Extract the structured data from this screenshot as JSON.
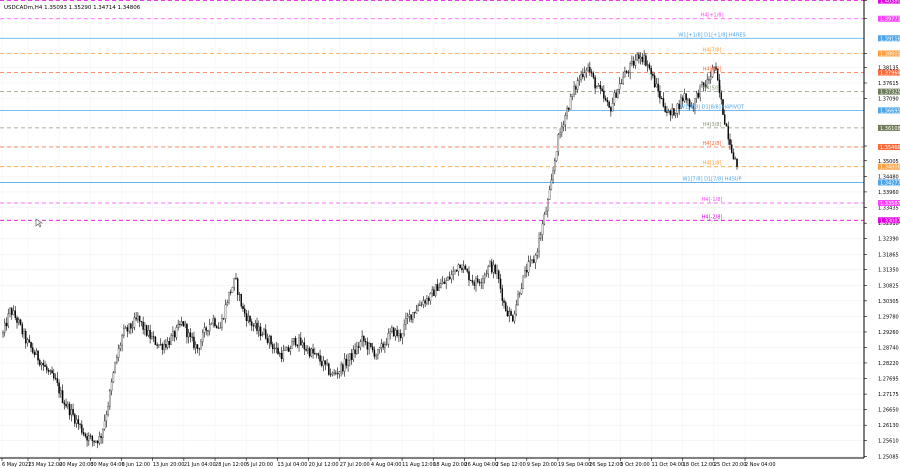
{
  "chart_data": {
    "type": "candlestick",
    "title": "USDCADm,H4  1.35093 1.35290 1.34714 1.34806",
    "ylim": [
      1.2503,
      1.404
    ],
    "grid": true,
    "y_ticks": [
      "1.40380",
      "1.39771",
      "1.38605",
      "1.38135",
      "1.37615",
      "1.37090",
      "1.35500",
      "1.35005",
      "1.34480",
      "1.33960",
      "1.33435",
      "1.32910",
      "1.32390",
      "1.31865",
      "1.31350",
      "1.30825",
      "1.30305",
      "1.29780",
      "1.29260",
      "1.28740",
      "1.28220",
      "1.27695",
      "1.27175",
      "1.26650",
      "1.26130",
      "1.25610",
      "1.25085"
    ],
    "x_ticks": [
      "6 May 2022",
      "13 May 12:00",
      "20 May 20:00",
      "30 May 04:00",
      "6 Jun 12:00",
      "13 Jun 20:00",
      "21 Jun 04:00",
      "28 Jun 12:00",
      "5 Jul 20:00",
      "13 Jul 04:00",
      "20 Jul 12:00",
      "27 Jul 20:00",
      "4 Aug 04:00",
      "11 Aug 12:00",
      "18 Aug 20:00",
      "26 Aug 04:00",
      "2 Sep 12:00",
      "9 Sep 20:00",
      "19 Sep 04:00",
      "26 Sep 12:00",
      "3 Oct 20:00",
      "11 Oct 04:00",
      "18 Oct 12:00",
      "25 Oct 20:00",
      "2 Nov 04:00"
    ],
    "price_path": [
      1.292,
      1.3,
      1.296,
      1.29,
      1.286,
      1.283,
      1.279,
      1.276,
      1.27,
      1.266,
      1.262,
      1.258,
      1.256,
      1.257,
      1.268,
      1.282,
      1.292,
      1.294,
      1.297,
      1.293,
      1.29,
      1.288,
      1.289,
      1.292,
      1.296,
      1.29,
      1.287,
      1.293,
      1.297,
      1.294,
      1.304,
      1.31,
      1.3,
      1.296,
      1.293,
      1.292,
      1.288,
      1.285,
      1.286,
      1.29,
      1.288,
      1.286,
      1.284,
      1.281,
      1.278,
      1.28,
      1.283,
      1.286,
      1.29,
      1.287,
      1.285,
      1.289,
      1.293,
      1.291,
      1.297,
      1.3,
      1.303,
      1.304,
      1.308,
      1.309,
      1.312,
      1.316,
      1.312,
      1.309,
      1.311,
      1.315,
      1.312,
      1.301,
      1.297,
      1.307,
      1.314,
      1.317,
      1.328,
      1.339,
      1.356,
      1.365,
      1.372,
      1.378,
      1.382,
      1.376,
      1.372,
      1.367,
      1.374,
      1.379,
      1.382,
      1.386,
      1.383,
      1.376,
      1.37,
      1.365,
      1.368,
      1.372,
      1.368,
      1.374,
      1.376,
      1.382,
      1.368,
      1.357,
      1.3481
    ],
    "hlines": [
      {
        "label": "H4[+2/8]",
        "price": 1.4038,
        "color": "#e000e0",
        "dash": true,
        "tag": "1.40380"
      },
      {
        "label": "H4[+1/8]",
        "price": 1.39771,
        "color": "#ff44ff",
        "dash": true,
        "tag": "1.39771"
      },
      {
        "label": "W1[+1/8] D1[+1/8] H4RES",
        "price": 1.39116,
        "color": "#4ea6e8",
        "dash": false,
        "tag": "1.39116"
      },
      {
        "label": "H4[7/8]",
        "price": 1.38605,
        "color": "#ffa040",
        "dash": true,
        "tag": "1.38605"
      },
      {
        "label": "H4[6/8]",
        "price": 1.37964,
        "color": "#ff6a3a",
        "dash": true,
        "tag": "1.37964"
      },
      {
        "label": "H4[5/8]",
        "price": 1.37325,
        "color": "#8a9a7a",
        "dash": true,
        "tag": "1.37325"
      },
      {
        "label": "W1[8/8] D1[8/8] H4PIVOT",
        "price": 1.36695,
        "color": "#4ea6e8",
        "dash": false,
        "tag": "1.36695"
      },
      {
        "label": "H4[3/8]",
        "price": 1.36108,
        "color": "#8a9a7a",
        "dash": true,
        "tag": "1.36108"
      },
      {
        "label": "H4[2/8]",
        "price": 1.35466,
        "color": "#ff6a3a",
        "dash": true,
        "tag": "1.35466"
      },
      {
        "label": "H4[1/8]",
        "price": 1.34806,
        "color": "#ffa040",
        "dash": true,
        "tag": "1.34806"
      },
      {
        "label": "W1[7/8] D1[7/8] H4SUP",
        "price": 1.34277,
        "color": "#4ea6e8",
        "dash": false,
        "tag": "1.34277"
      },
      {
        "label": "H4[-1/8]",
        "price": 1.33587,
        "color": "#ff44ff",
        "dash": true,
        "tag": "1.33587"
      },
      {
        "label": "H4[-2/8]",
        "price": 1.33007,
        "color": "#e000e0",
        "dash": true,
        "tag": "1.33007"
      }
    ],
    "tags": [
      {
        "text": "1.40380",
        "price": 1.4038,
        "color": "#e000e0"
      },
      {
        "text": "1.39771",
        "price": 1.39771,
        "color": "#ff44ff"
      },
      {
        "text": "1.39116",
        "price": 1.39116,
        "color": "#4ea6e8"
      },
      {
        "text": "1.38605",
        "price": 1.38605,
        "color": "#ffa040"
      },
      {
        "text": "1.37964",
        "price": 1.37964,
        "color": "#ff6a3a"
      },
      {
        "text": "1.37325",
        "price": 1.37325,
        "color": "#6d7c5a"
      },
      {
        "text": "1.36695",
        "price": 1.36695,
        "color": "#4ea6e8"
      },
      {
        "text": "1.36108",
        "price": 1.36108,
        "color": "#6d7c5a"
      },
      {
        "text": "1.35466",
        "price": 1.35466,
        "color": "#ff6a3a"
      },
      {
        "text": "1.34806",
        "price": 1.34806,
        "color": "#ffa040"
      },
      {
        "text": "1.34277",
        "price": 1.34277,
        "color": "#4ea6e8"
      },
      {
        "text": "1.33587",
        "price": 1.33587,
        "color": "#ff44ff"
      },
      {
        "text": "1.33007",
        "price": 1.33007,
        "color": "#e000e0"
      }
    ]
  }
}
